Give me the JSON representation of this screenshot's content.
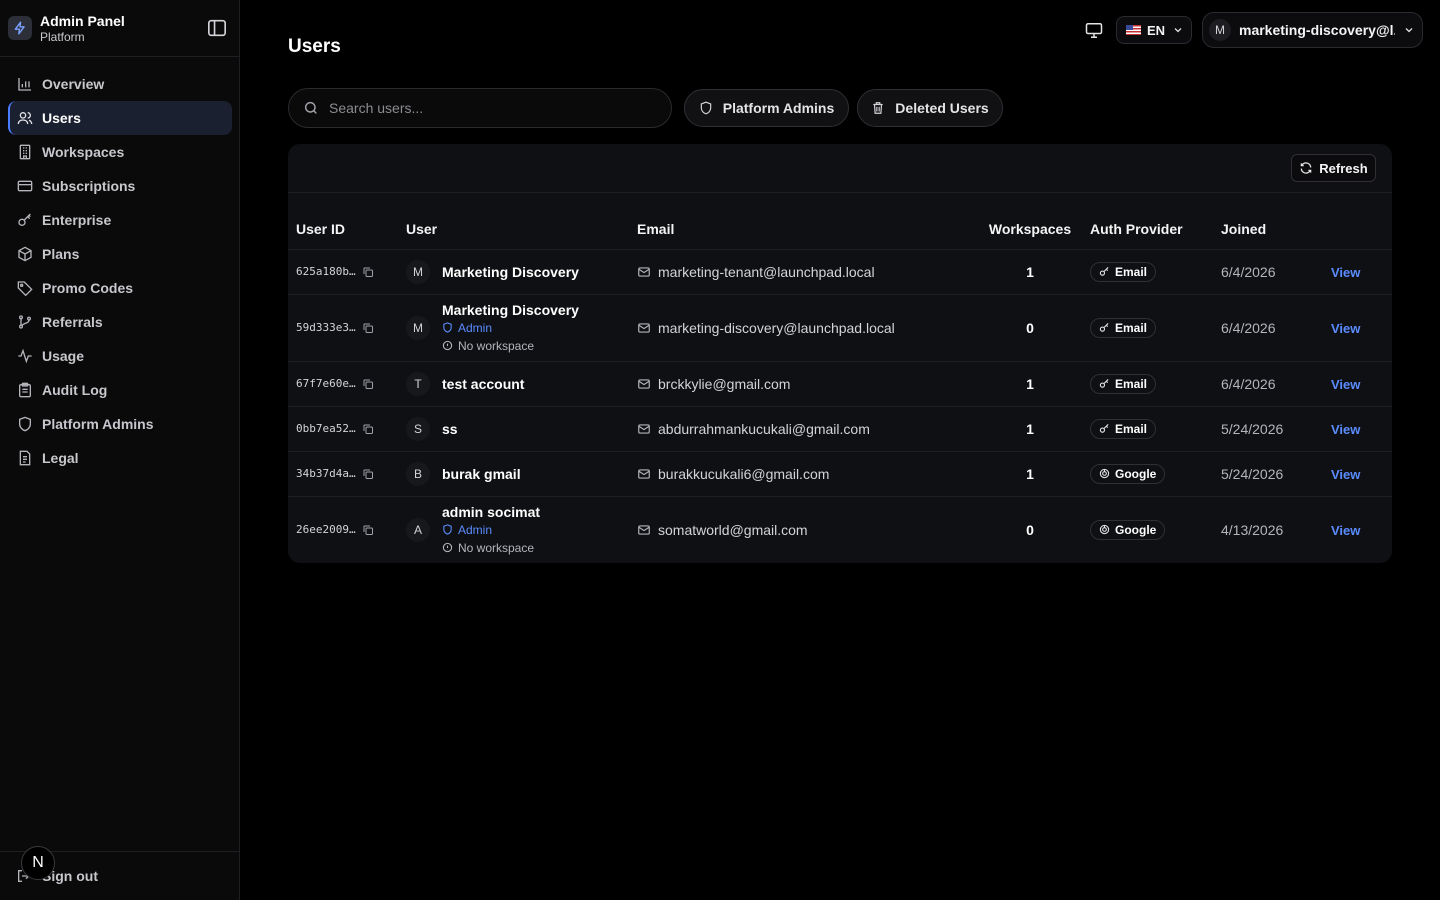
{
  "brand": {
    "title": "Admin Panel",
    "subtitle": "Platform"
  },
  "sidebar": {
    "items": [
      {
        "label": "Overview",
        "icon": "bar-chart-icon"
      },
      {
        "label": "Users",
        "icon": "users-icon",
        "active": true
      },
      {
        "label": "Workspaces",
        "icon": "building-icon"
      },
      {
        "label": "Subscriptions",
        "icon": "credit-card-icon"
      },
      {
        "label": "Enterprise",
        "icon": "key-icon"
      },
      {
        "label": "Plans",
        "icon": "package-icon"
      },
      {
        "label": "Promo Codes",
        "icon": "tag-icon"
      },
      {
        "label": "Referrals",
        "icon": "git-branch-icon"
      },
      {
        "label": "Usage",
        "icon": "activity-icon"
      },
      {
        "label": "Audit Log",
        "icon": "clipboard-icon"
      },
      {
        "label": "Platform Admins",
        "icon": "shield-icon"
      },
      {
        "label": "Legal",
        "icon": "file-icon"
      }
    ],
    "signout": "Sign out",
    "badge": "N"
  },
  "header": {
    "title": "Users",
    "language": "EN",
    "account_initial": "M",
    "account_name": "marketing-discovery@l..."
  },
  "toolbar": {
    "search_placeholder": "Search users...",
    "platform_admins": "Platform Admins",
    "deleted_users": "Deleted Users",
    "refresh": "Refresh"
  },
  "table": {
    "headers": {
      "id": "User ID",
      "user": "User",
      "email": "Email",
      "workspaces": "Workspaces",
      "auth": "Auth Provider",
      "joined": "Joined"
    },
    "view_label": "View",
    "rows": [
      {
        "id": "625a180b…",
        "initial": "M",
        "name": "Marketing Discovery",
        "role": "",
        "ws_note": "",
        "email": "marketing-tenant@launchpad.local",
        "workspaces": "1",
        "auth": "Email",
        "joined": "6/4/2026"
      },
      {
        "id": "59d333e3…",
        "initial": "M",
        "name": "Marketing Discovery",
        "role": "Admin",
        "ws_note": "No workspace",
        "email": "marketing-discovery@launchpad.local",
        "workspaces": "0",
        "auth": "Email",
        "joined": "6/4/2026"
      },
      {
        "id": "67f7e60e…",
        "initial": "T",
        "name": "test account",
        "role": "",
        "ws_note": "",
        "email": "brckkylie@gmail.com",
        "workspaces": "1",
        "auth": "Email",
        "joined": "6/4/2026"
      },
      {
        "id": "0bb7ea52…",
        "initial": "S",
        "name": "ss",
        "role": "",
        "ws_note": "",
        "email": "abdurrahmankucukali@gmail.com",
        "workspaces": "1",
        "auth": "Email",
        "joined": "5/24/2026"
      },
      {
        "id": "34b37d4a…",
        "initial": "B",
        "name": "burak gmail",
        "role": "",
        "ws_note": "",
        "email": "burakkucukali6@gmail.com",
        "workspaces": "1",
        "auth": "Google",
        "joined": "5/24/2026"
      },
      {
        "id": "26ee2009…",
        "initial": "A",
        "name": "admin socimat",
        "role": "Admin",
        "ws_note": "No workspace",
        "email": "somatworld@gmail.com",
        "workspaces": "0",
        "auth": "Google",
        "joined": "4/13/2026"
      }
    ]
  },
  "colors": {
    "accent": "#5b8cff",
    "background": "#000000",
    "sidebar": "#0a0a0b",
    "card": "#0f1013"
  }
}
